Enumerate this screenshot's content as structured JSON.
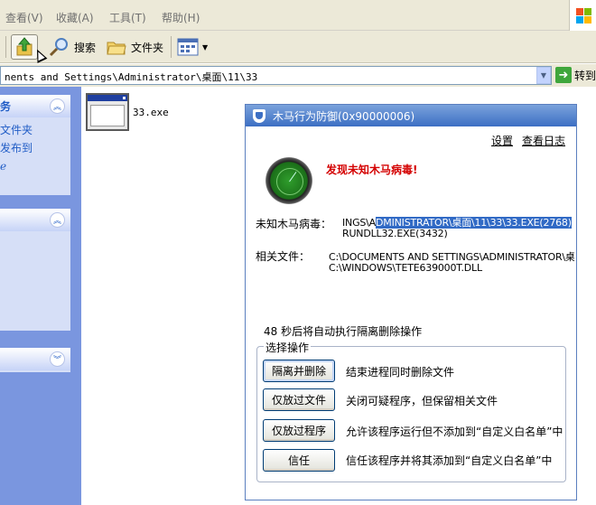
{
  "menubar": {
    "items": [
      "查看(V)",
      "收藏(A)",
      "工具(T)",
      "帮助(H)"
    ]
  },
  "toolbar": {
    "search_label": "搜索",
    "folders_label": "文件夹"
  },
  "addressbar": {
    "path": "nents and Settings\\Administrator\\桌面\\11\\33",
    "go_label": "转到"
  },
  "sidebar": {
    "task_title": "务",
    "links": [
      "文件夹",
      "发布到"
    ],
    "extra": "ℯ"
  },
  "files": [
    {
      "name": "33.exe"
    }
  ],
  "dialog": {
    "title": "木马行为防御(0x90000006)",
    "settings_link": "设置",
    "log_link": "查看日志",
    "alert": "发现未知木马病毒!",
    "virus_label": "未知木马病毒：",
    "virus_path_1_plain": "INGS\\A",
    "virus_path_1_highlighted": "DMINISTRATOR\\桌面\\11\\33\\33.EXE(2768)",
    "virus_path_2": "RUNDLL32.EXE(3432)",
    "related_label": "相关文件：",
    "related_path_1": "C:\\DOCUMENTS AND SETTINGS\\ADMINISTRATOR\\桌",
    "related_path_2": "C:\\WINDOWS\\TETE639000T.DLL",
    "countdown": "48 秒后将自动执行隔离删除操作",
    "group_title": "选择操作",
    "actions": [
      {
        "label": "隔离并删除",
        "desc": "结束进程同时删除文件"
      },
      {
        "label": "仅放过文件",
        "desc": "关闭可疑程序，但保留相关文件"
      },
      {
        "label": "仅放过程序",
        "desc": "允许该程序运行但不添加到“自定义白名单”中"
      },
      {
        "label": "信任",
        "desc": "信任该程序并将其添加到“自定义白名单”中"
      }
    ]
  }
}
